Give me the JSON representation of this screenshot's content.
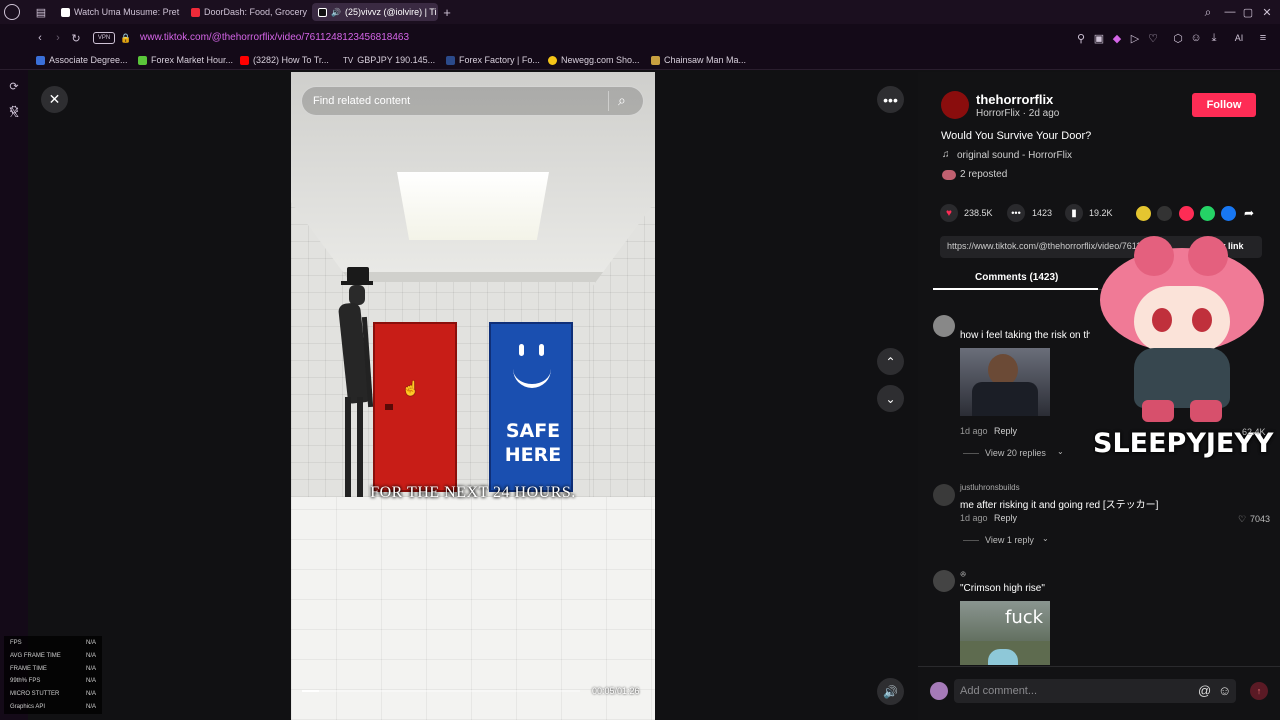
{
  "browser": {
    "tabs": [
      {
        "label": "Watch Uma Musume: Pret"
      },
      {
        "label": "DoorDash: Food, Grocery"
      },
      {
        "label": "(25)vivvz (@iolvire) | Ti"
      }
    ],
    "vpn_label": "VPN",
    "url": "www.tiktok.com/@thehorrorflix/video/7611248123456818463",
    "ai_label": "AI",
    "bookmarks": [
      {
        "label": "Associate Degree..."
      },
      {
        "label": "Forex Market Hour..."
      },
      {
        "label": "(3282) How To Tr..."
      },
      {
        "label": "GBPJPY 190.145..."
      },
      {
        "label": "Forex Factory | Fo..."
      },
      {
        "label": "Newegg.com Sho..."
      },
      {
        "label": "Chainsaw Man Ma..."
      }
    ]
  },
  "video": {
    "search_placeholder": "Find related content",
    "door_text_line1": "SAFE",
    "door_text_line2": "HERE",
    "caption": "FOR THE NEXT 24 HOURS.",
    "time": "00:05/01:26",
    "progress": 0.06
  },
  "author": {
    "username": "thehorrorflix",
    "meta": "HorrorFlix · 2d ago",
    "follow_label": "Follow",
    "description": "Would You Survive Your Door?",
    "sound": "original sound - HorrorFlix",
    "reposted": "2 reposted"
  },
  "stats": {
    "likes": "238.5K",
    "comments": "1423",
    "saves": "19.2K"
  },
  "link": {
    "url": "https://www.tiktok.com/@thehorrorflix/video/7611248",
    "copy_label": "Copy link"
  },
  "tabs": {
    "comments_label": "Comments (1423)"
  },
  "comments": [
    {
      "user": "",
      "text": "how i feel taking the risk on the red door",
      "time": "1d ago",
      "reply": "Reply",
      "likes": "62.4K",
      "replies": "View 20 replies"
    },
    {
      "user": "justluhronsbuilds",
      "text": "me after risking it and going red [ステッカー]",
      "time": "1d ago",
      "reply": "Reply",
      "likes": "7043",
      "replies": "View 1 reply"
    },
    {
      "user": "ꔮ",
      "text": "\"Crimson high rise\"",
      "image_text": "fuck"
    }
  ],
  "add_comment_placeholder": "Add comment...",
  "overlay": {
    "name": "SLEEPYJEYY"
  },
  "perf": [
    {
      "label": "FPS",
      "value": "N/A"
    },
    {
      "label": "AVG FRAME TIME",
      "value": "N/A"
    },
    {
      "label": "FRAME TIME",
      "value": "N/A"
    },
    {
      "label": "99th% FPS",
      "value": "N/A"
    },
    {
      "label": "MICRO STUTTER",
      "value": "N/A"
    },
    {
      "label": "Graphics API",
      "value": "N/A"
    }
  ],
  "colors": {
    "accent": "#fe2c55",
    "url": "#d565e8"
  }
}
